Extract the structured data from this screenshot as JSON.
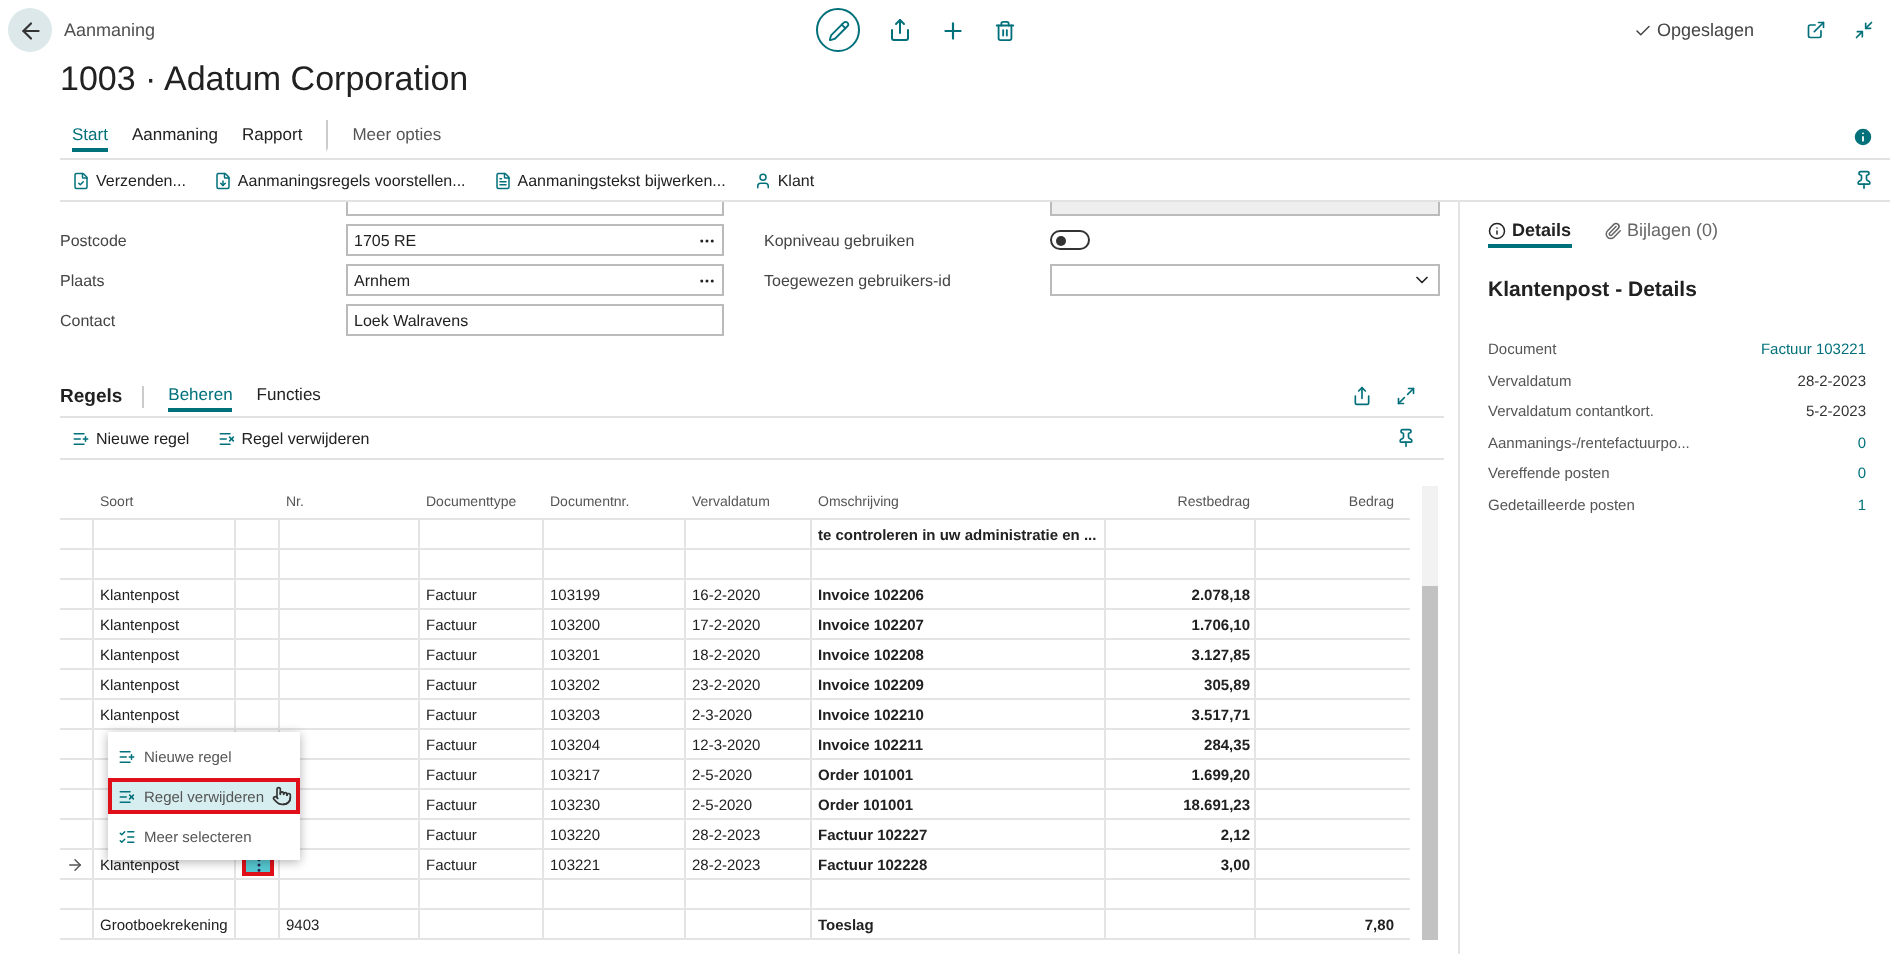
{
  "breadcrumb": "Aanmaning",
  "title": "1003 · Adatum Corporation",
  "status": "Opgeslagen",
  "tabs": [
    {
      "label": "Start",
      "selected": true
    },
    {
      "label": "Aanmaning",
      "selected": false
    },
    {
      "label": "Rapport",
      "selected": false
    },
    {
      "label": "Meer opties",
      "selected": false
    }
  ],
  "actions": [
    "Verzenden...",
    "Aanmaningsregels voorstellen...",
    "Aanmaningstekst bijwerken...",
    "Klant"
  ],
  "fields_left": [
    {
      "label": "Postcode",
      "value": "1705 RE",
      "lookup": true
    },
    {
      "label": "Plaats",
      "value": "Arnhem",
      "lookup": true
    },
    {
      "label": "Contact",
      "value": "Loek Walravens",
      "lookup": false
    }
  ],
  "fields_right": [
    {
      "label": "Kopniveau gebruiken",
      "kind": "toggle",
      "on": false
    },
    {
      "label": "Toegewezen gebruikers-id",
      "kind": "dropdown"
    }
  ],
  "lines": {
    "title": "Regels",
    "tabs": [
      {
        "label": "Beheren",
        "selected": true
      },
      {
        "label": "Functies",
        "selected": false
      }
    ],
    "actions": [
      "Nieuwe regel",
      "Regel verwijderen"
    ],
    "columns": [
      "Soort",
      "Nr.",
      "Documenttype",
      "Documentnr.",
      "Vervaldatum",
      "Omschrijving",
      "Restbedrag",
      "Bedrag"
    ],
    "rows": [
      {
        "soort": "",
        "nr": "",
        "type": "",
        "docnr": "",
        "date": "",
        "desc": "te controleren in uw administratie en ...",
        "rest": "",
        "amount": "",
        "current": false
      },
      {
        "soort": "",
        "nr": "",
        "type": "",
        "docnr": "",
        "date": "",
        "desc": "",
        "rest": "",
        "amount": "",
        "current": false
      },
      {
        "soort": "Klantenpost",
        "nr": "",
        "type": "Factuur",
        "docnr": "103199",
        "date": "16-2-2020",
        "desc": "Invoice 102206",
        "rest": "2.078,18",
        "amount": "",
        "current": false
      },
      {
        "soort": "Klantenpost",
        "nr": "",
        "type": "Factuur",
        "docnr": "103200",
        "date": "17-2-2020",
        "desc": "Invoice 102207",
        "rest": "1.706,10",
        "amount": "",
        "current": false
      },
      {
        "soort": "Klantenpost",
        "nr": "",
        "type": "Factuur",
        "docnr": "103201",
        "date": "18-2-2020",
        "desc": "Invoice 102208",
        "rest": "3.127,85",
        "amount": "",
        "current": false
      },
      {
        "soort": "Klantenpost",
        "nr": "",
        "type": "Factuur",
        "docnr": "103202",
        "date": "23-2-2020",
        "desc": "Invoice 102209",
        "rest": "305,89",
        "amount": "",
        "current": false
      },
      {
        "soort": "Klantenpost",
        "nr": "",
        "type": "Factuur",
        "docnr": "103203",
        "date": "2-3-2020",
        "desc": "Invoice 102210",
        "rest": "3.517,71",
        "amount": "",
        "current": false
      },
      {
        "soort": "",
        "nr": "",
        "type": "Factuur",
        "docnr": "103204",
        "date": "12-3-2020",
        "desc": "Invoice 102211",
        "rest": "284,35",
        "amount": "",
        "current": false
      },
      {
        "soort": "",
        "nr": "",
        "type": "Factuur",
        "docnr": "103217",
        "date": "2-5-2020",
        "desc": "Order 101001",
        "rest": "1.699,20",
        "amount": "",
        "current": false
      },
      {
        "soort": "",
        "nr": "",
        "type": "Factuur",
        "docnr": "103230",
        "date": "2-5-2020",
        "desc": "Order 101001",
        "rest": "18.691,23",
        "amount": "",
        "current": false
      },
      {
        "soort": "",
        "nr": "",
        "type": "Factuur",
        "docnr": "103220",
        "date": "28-2-2023",
        "desc": "Factuur 102227",
        "rest": "2,12",
        "amount": "",
        "current": false
      },
      {
        "soort": "Klantenpost",
        "nr": "",
        "type": "Factuur",
        "docnr": "103221",
        "date": "28-2-2023",
        "desc": "Factuur 102228",
        "rest": "3,00",
        "amount": "",
        "current": true
      },
      {
        "soort": "",
        "nr": "",
        "type": "",
        "docnr": "",
        "date": "",
        "desc": "",
        "rest": "",
        "amount": "",
        "current": false
      },
      {
        "soort": "Grootboekrekening",
        "nr": "9403",
        "type": "",
        "docnr": "",
        "date": "",
        "desc": "Toeslag",
        "rest": "",
        "amount": "7,80",
        "current": false
      }
    ],
    "menu": [
      {
        "label": "Nieuwe regel",
        "selected": false
      },
      {
        "label": "Regel verwijderen",
        "selected": true
      },
      {
        "label": "Meer selecteren",
        "selected": false
      }
    ]
  },
  "factbox": {
    "tabs": [
      {
        "label": "Details",
        "selected": true
      },
      {
        "label": "Bijlagen (0)",
        "selected": false
      }
    ],
    "title": "Klantenpost - Details",
    "rows": [
      {
        "label": "Document",
        "value": "Factuur 103221",
        "link": true
      },
      {
        "label": "Vervaldatum",
        "value": "28-2-2023",
        "link": false
      },
      {
        "label": "Vervaldatum contantkort.",
        "value": "5-2-2023",
        "link": false
      },
      {
        "label": "Aanmanings-/rentefactuurpo...",
        "value": "0",
        "link": true
      },
      {
        "label": "Vereffende posten",
        "value": "0",
        "link": true
      },
      {
        "label": "Gedetailleerde posten",
        "value": "1",
        "link": true
      }
    ]
  }
}
